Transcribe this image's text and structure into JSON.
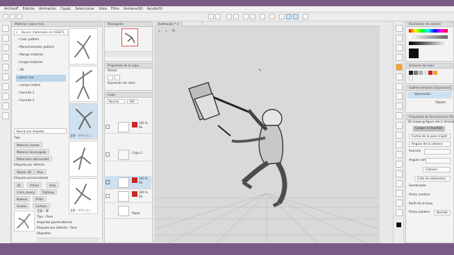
{
  "menu": [
    "ArchivoF",
    "Edición",
    "Animación",
    "CapaL",
    "Seleccionar",
    "Vista",
    "Filtro",
    "Ventana(W)",
    "Ayuda(H)"
  ],
  "canvas_tab": {
    "label": "Ilustración *",
    "close": "×"
  },
  "materials": {
    "title": "Material: [pose más",
    "search_placeholder": "Buscar materiales en ASSETS",
    "tree": [
      {
        "label": "Color pattern",
        "selected": false
      },
      {
        "label": "Monochromatic pattern",
        "selected": false
      },
      {
        "label": "Manga material",
        "selected": false
      },
      {
        "label": "Image material",
        "selected": false
      },
      {
        "label": "3D",
        "selected": false
      },
      {
        "label": "poses mo",
        "selected": true
      },
      {
        "label": "cuerpo entero",
        "selected": false
      },
      {
        "label": "Favorite 1",
        "selected": false
      },
      {
        "label": "Favorite 2",
        "selected": false
      }
    ],
    "thumb_label_1": "全身・アクション",
    "thumb_label_2": "全身・アクション",
    "tags_placeholder": "Buscar por etiqueta",
    "type_label": "Tipo",
    "type_options": [
      "Material creado",
      "Material descargado",
      "Materiales adicionales"
    ],
    "default_tag_label": "Etiqueta por defecto",
    "default_tags": [
      "Objeto 3D",
      "Pose"
    ],
    "custom_tag_label": "Etiqueta personalizada",
    "custom_tags": [
      "3D",
      "Action",
      "Hiop",
      "Cntre_beasy",
      "Fighting",
      "Nubeat",
      "PVSts",
      "Gestos",
      "Cartoon"
    ],
    "detail_name": "全身・斧",
    "detail_type": "Tipo : Pose",
    "detail_author": "Hogenba ppartuabiecos",
    "detail_tags": "Etiqueta por defecto : Pose",
    "detail_option": "Etiquetas"
  },
  "navigator": {
    "title": "Navegador"
  },
  "layer_props": {
    "title": "Propiedad de la capa",
    "effect_label": "Efecto",
    "expression_label": "Expresión de color"
  },
  "layers": {
    "title": "Capa",
    "blend": "Normal",
    "opacity": "100",
    "items": [
      {
        "percent": "100 %",
        "name": "Ro"
      },
      {
        "percent": "",
        "name": "Capa 2"
      },
      {
        "percent": "100 %",
        "name": "Ro"
      },
      {
        "percent": "100 %",
        "name": "Ro"
      },
      {
        "percent": "",
        "name": "Papel"
      }
    ]
  },
  "color_wheel": {
    "title": "Deslizador de colores"
  },
  "color_history": {
    "title": "Historial de color"
  },
  "sub_tool": {
    "title": "Subherramienta [Operación]",
    "items": [
      "Operación",
      "Objeto"
    ]
  },
  "tool_property": {
    "title": "Propiedad de herramienta [Objeto]",
    "object_name": "3D drawing figure Ver.2 (female)",
    "section": "Cargar a CloudSDI",
    "fields": [
      {
        "label": "",
        "value": "Forma de la pose (rigid)"
      },
      {
        "label": "",
        "value": "Ángulo de la cámara"
      },
      {
        "label": "Posición",
        "value": ""
      },
      {
        "label": "Ángulo cámara",
        "value": ""
      },
      {
        "label": "",
        "value": "Cámara"
      },
      {
        "label": "",
        "value": "Lista de elementos"
      },
      {
        "label": "Sombreado",
        "value": ""
      },
      {
        "label": "Pintar sombra",
        "value": ""
      },
      {
        "label": "Perfil de la línea",
        "value": ""
      },
      {
        "label": "Pintar palabra",
        "value": "Normal"
      }
    ]
  },
  "colors": {
    "purple": "#7c5a86",
    "accent": "#cfe3f3",
    "selected": "#cde0f0",
    "orange": "#f5a32a",
    "red": "#c62828"
  }
}
